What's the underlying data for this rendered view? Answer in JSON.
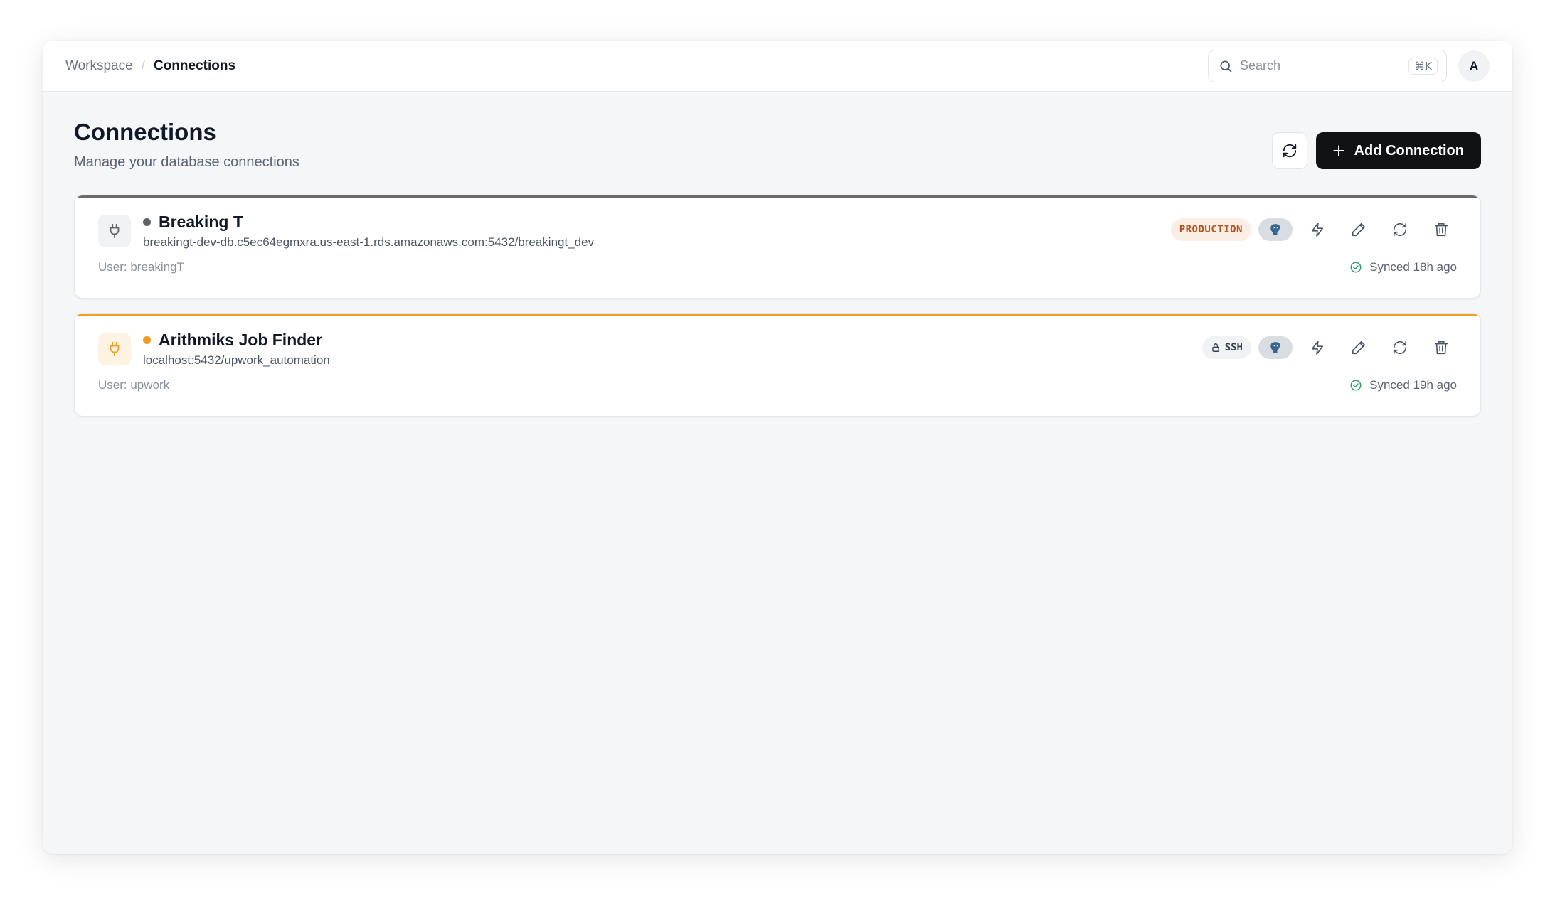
{
  "breadcrumb": {
    "root": "Workspace",
    "separator": "/",
    "current": "Connections"
  },
  "search": {
    "placeholder": "Search",
    "shortcut": "⌘K"
  },
  "user": {
    "avatar_initial": "A"
  },
  "page": {
    "title": "Connections",
    "subtitle": "Manage your database connections",
    "add_button_label": "Add Connection"
  },
  "connections": [
    {
      "name": "Breaking T",
      "host": "breakingt-dev-db.c5ec64egmxra.us-east-1.rds.amazonaws.com:5432/breakingt_dev",
      "user": "User: breakingT",
      "badge": "PRODUCTION",
      "db_icon": "postgresql-elephant-icon",
      "synced": "Synced 18h ago",
      "accent_color": "#6b6b6b",
      "status_color": "#5f6368"
    },
    {
      "name": "Arithmiks Job Finder",
      "host": "localhost:5432/upwork_automation",
      "user": "User: upwork",
      "badge": "SSH",
      "db_icon": "postgresql-elephant-icon",
      "synced": "Synced 19h ago",
      "accent_color": "#f0a020",
      "status_color": "#f29a1f"
    }
  ],
  "colors": {
    "primary_button": "#111214",
    "synced_check": "#2f9e6e",
    "production_badge_bg": "#fbeee5",
    "production_badge_text": "#b4541c"
  }
}
